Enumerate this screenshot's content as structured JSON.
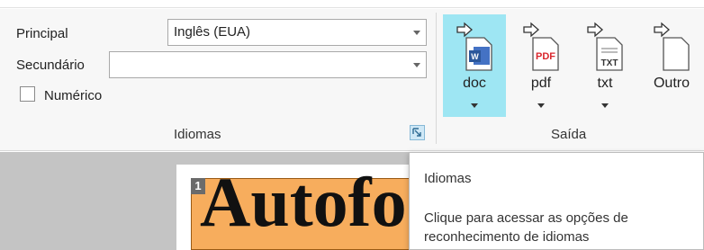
{
  "languages": {
    "primary_label": "Principal",
    "primary_value": "Inglês (EUA)",
    "secondary_label": "Secundário",
    "secondary_value": "",
    "numeric_label": "Numérico",
    "numeric_checked": false,
    "group_title": "Idiomas"
  },
  "output": {
    "group_title": "Saída",
    "buttons": [
      {
        "label": "doc",
        "icon": "word-doc-icon",
        "active": true
      },
      {
        "label": "pdf",
        "icon": "pdf-file-icon",
        "active": false
      },
      {
        "label": "txt",
        "icon": "txt-file-icon",
        "active": false
      },
      {
        "label": "Outro",
        "icon": "generic-file-icon",
        "active": false
      }
    ]
  },
  "document": {
    "block_number": "1",
    "recognized_text": "Autofo"
  },
  "tooltip": {
    "title": "Idiomas",
    "body": "Clique para acessar as opções de reconhecimento de idiomas"
  },
  "colors": {
    "active_button": "#9ee6f3",
    "highlight": "#f7ad5d",
    "word_blue": "#2b579a",
    "pdf_red": "#d9262c"
  }
}
